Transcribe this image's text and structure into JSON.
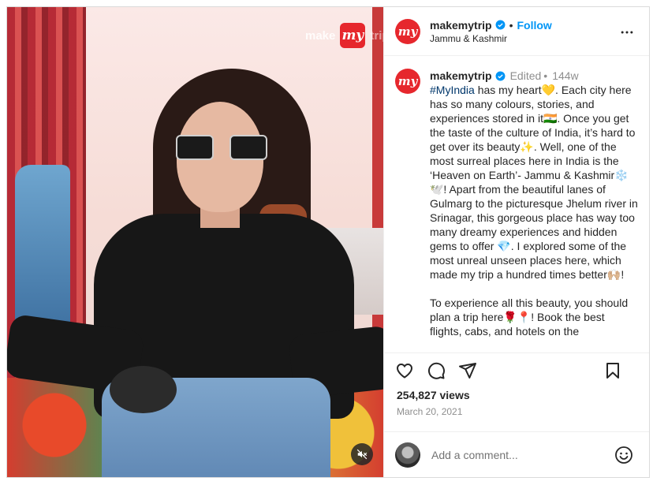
{
  "post": {
    "username": "makemytrip",
    "avatar_text": "my",
    "location": "Jammu & Kashmir",
    "follow_label": "Follow",
    "separator": "•",
    "edited_label": "Edited",
    "age": "144w"
  },
  "media": {
    "logo_text": "make",
    "logo_mark": "my",
    "logo_suffix": "trip"
  },
  "caption": {
    "hashtag": "#MyIndia",
    "para1": " has my heart💛. Each city here has so many colours, stories, and experiences stored in it🇮🇳. Once you get the taste of the culture of India, it’s hard to get over its beauty✨. Well, one of the most surreal places here in India is the ‘Heaven on Earth’- Jammu & Kashmir❄️🕊️! Apart from the beautiful lanes of Gulmarg to the picturesque Jhelum river in Srinagar, this gorgeous place has way too many dreamy experiences and hidden gems to offer 💎. I explored some of the most unreal unseen places here, which made my trip a hundred times better🙌🏼!",
    "para2": "To experience all this beauty, you should plan a trip here🌹📍! Book the best flights, cabs, and hotels on the"
  },
  "stats": {
    "views": "254,827 views",
    "date": "March 20, 2021"
  },
  "comment": {
    "placeholder": "Add a comment..."
  },
  "icons": {
    "more": "more-options-icon",
    "like": "heart-icon",
    "comment": "comment-icon",
    "share": "share-icon",
    "save": "bookmark-icon",
    "emoji": "emoji-icon",
    "mute": "muted-speaker-icon",
    "verified": "verified-badge-icon"
  },
  "colors": {
    "brand_red": "#e6272d",
    "follow_blue": "#0095f6",
    "hashtag_blue": "#00376b",
    "muted_text": "#8e8e8e"
  }
}
